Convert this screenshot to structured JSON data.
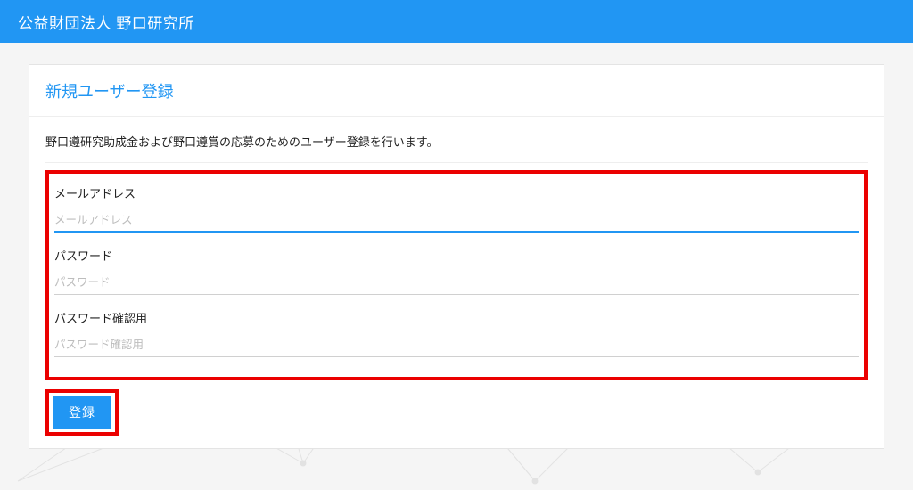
{
  "header": {
    "title": "公益財団法人 野口研究所"
  },
  "card": {
    "title": "新規ユーザー登録",
    "intro": "野口遵研究助成金および野口遵賞の応募のためのユーザー登録を行います。"
  },
  "fields": {
    "email": {
      "label": "メールアドレス",
      "placeholder": "メールアドレス",
      "value": ""
    },
    "password": {
      "label": "パスワード",
      "placeholder": "パスワード",
      "value": ""
    },
    "confirm": {
      "label": "パスワード確認用",
      "placeholder": "パスワード確認用",
      "value": ""
    }
  },
  "submit": {
    "label": "登録"
  },
  "colors": {
    "accent": "#2196F3",
    "highlight_border": "#eb0000"
  }
}
